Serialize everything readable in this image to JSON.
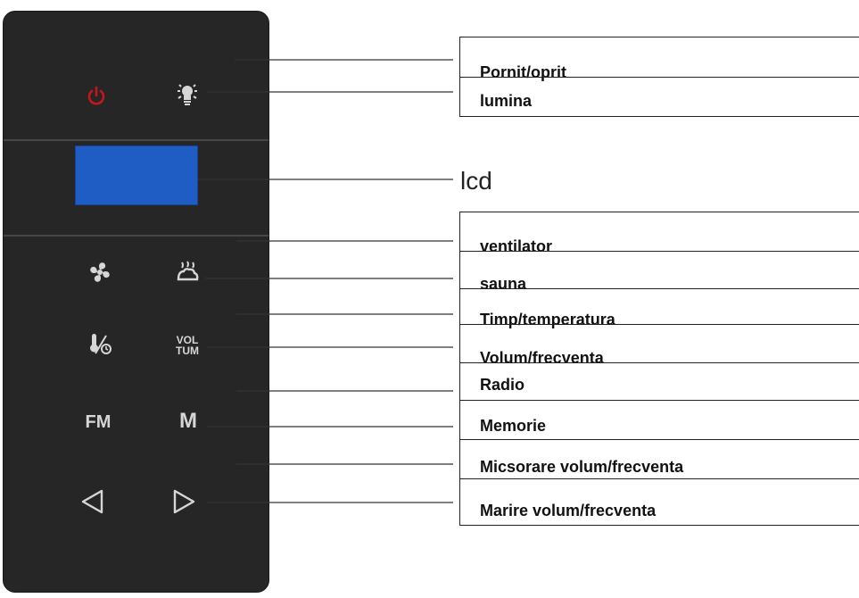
{
  "panel": {
    "buttons": {
      "fm": "FM",
      "memory": "M",
      "vol_top": "VOL",
      "vol_bottom": "TUM"
    }
  },
  "labels": {
    "power": "Pornit/oprit",
    "light": "lumina",
    "lcd": "lcd",
    "fan": "ventilator",
    "sauna": "sauna",
    "time_temp": "Timp/temperatura",
    "vol_freq": "Volum/frecventa",
    "radio": "Radio",
    "memory": "Memorie",
    "decrease": "Micsorare volum/frecventa",
    "increase": "Marire volum/frecventa"
  },
  "colors": {
    "panel": "#262626",
    "lcd_screen": "#1f5cc4",
    "power_icon": "#c4161c",
    "icon": "#d6d6d6"
  },
  "icons": {
    "power": "power-icon",
    "light": "bulb-icon",
    "fan": "fan-icon",
    "sauna": "sauna-steam-icon",
    "time_temp": "thermometer-clock-icon",
    "left": "triangle-left-icon",
    "right": "triangle-right-icon"
  }
}
